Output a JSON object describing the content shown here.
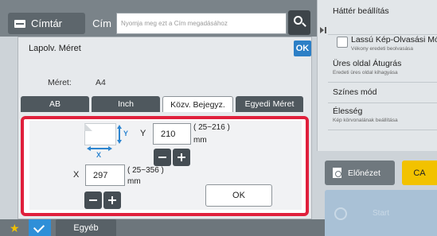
{
  "topbar": {
    "directory_label": "Címtár",
    "name_label": "Cím",
    "search_placeholder": "Nyomja meg ezt a Cím megadásához"
  },
  "right_panel": {
    "items": [
      {
        "title": "Háttér beállítás",
        "subtitle": ""
      },
      {
        "title": "Lassú Kép-Olvasási Mód",
        "subtitle": "Vékony eredeti beolvasása"
      },
      {
        "title": "Üres oldal Átugrás",
        "subtitle": "Eredeti üres oldal kihagyása"
      },
      {
        "title": "Színes mód",
        "subtitle": ""
      },
      {
        "title": "Élesség",
        "subtitle": "Kép körvonalának beállítása"
      }
    ],
    "preview_label": "Előnézet",
    "ca_label": "CA",
    "start_label": "Start"
  },
  "dialog": {
    "title": "Lapolv. Méret",
    "ok_label": "OK",
    "size_label": "Méret:",
    "size_value": "A4",
    "tabs": [
      {
        "label": "AB",
        "active": false
      },
      {
        "label": "Inch",
        "active": false
      },
      {
        "label": "Közv. Bejegyz.",
        "active": true
      },
      {
        "label": "Egyedi Méret",
        "active": false
      }
    ]
  },
  "custom_size": {
    "y_axis_label": "Y",
    "y_value": "210",
    "y_range": "( 25~216 )",
    "x_axis_label": "X",
    "x_value": "297",
    "x_range": "( 25~356 )",
    "unit": "mm",
    "ok_label": "OK",
    "accent_color": "#e0203c"
  },
  "bottombar": {
    "other_label": "Egyéb"
  }
}
